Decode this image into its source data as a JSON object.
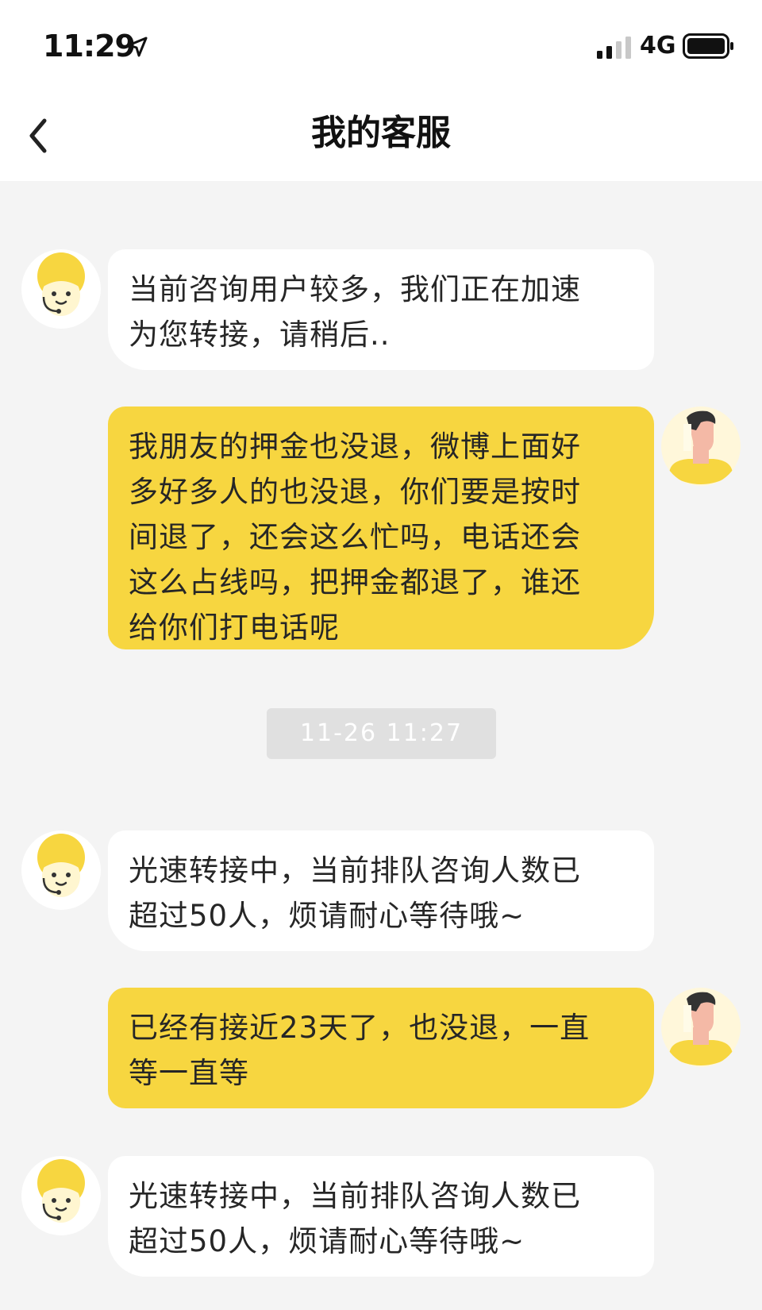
{
  "status_bar": {
    "time": "11:29",
    "network": "4G",
    "icons": [
      "location-arrow-icon",
      "signal-icon",
      "battery-icon"
    ]
  },
  "nav": {
    "title": "我的客服",
    "back_icon": "chevron-left-icon"
  },
  "colors": {
    "user_bubble": "#f7d640",
    "agent_bubble": "#ffffff",
    "background": "#f4f4f4"
  },
  "messages": [
    {
      "sender": "agent",
      "text": "当前咨询用户较多，我们正在加速\n为您转接，请稍后.."
    },
    {
      "sender": "user",
      "text": "我朋友的押金也没退，微博上面好\n多好多人的也没退，你们要是按时\n间退了，还会这么忙吗，电话还会\n这么占线吗，把押金都退了，谁还\n给你们打电话呢"
    },
    {
      "sender": "system",
      "text": "11-26 11:27"
    },
    {
      "sender": "agent",
      "text": "光速转接中，当前排队咨询人数已\n超过50人，烦请耐心等待哦~"
    },
    {
      "sender": "user",
      "text": "已经有接近23天了，也没退，一直\n等一直等"
    },
    {
      "sender": "agent",
      "text": "光速转接中，当前排队咨询人数已\n超过50人，烦请耐心等待哦~"
    }
  ]
}
